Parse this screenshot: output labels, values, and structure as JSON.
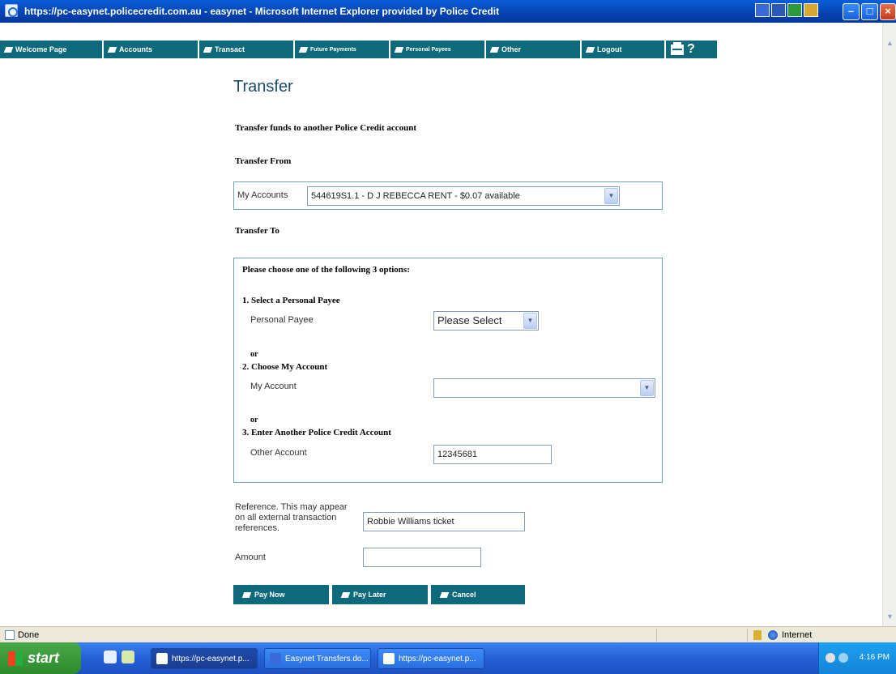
{
  "window": {
    "title": "https://pc-easynet.policecredit.com.au - easynet - Microsoft Internet Explorer provided by Police Credit"
  },
  "nav": {
    "items": [
      "Welcome Page",
      "Accounts",
      "Transact",
      "Future Payments",
      "Personal Payees",
      "Other",
      "Logout"
    ],
    "help": "?"
  },
  "page": {
    "title": "Transfer",
    "subtitle": "Transfer funds to another Police Credit account",
    "from_heading": "Transfer From",
    "from_label": "My Accounts",
    "from_value": "544619S1.1 - D J REBECCA RENT - $0.07 available",
    "to_heading": "Transfer To",
    "options_heading": "Please choose one of the following 3 options:",
    "opt1_title": "1. Select a Personal Payee",
    "opt1_label": "Personal Payee",
    "opt1_value": "Please Select",
    "or1": "or",
    "opt2_title": "2. Choose My Account",
    "opt2_label": "My Account",
    "opt2_value": "",
    "or2": "or",
    "opt3_title": "3. Enter Another Police Credit Account",
    "opt3_label": "Other Account",
    "opt3_value": "12345681",
    "reference_label": "Reference. This may appear on all external transaction references.",
    "reference_value": "Robbie Williams ticket",
    "amount_label": "Amount",
    "amount_value": ""
  },
  "buttons": {
    "pay_now": "Pay Now",
    "pay_later": "Pay Later",
    "cancel": "Cancel"
  },
  "statusbar": {
    "status": "Done",
    "zone": "Internet"
  },
  "taskbar": {
    "start": "start",
    "tasks": [
      "https://pc-easynet.p...",
      "Easynet Transfers.do...",
      "https://pc-easynet.p..."
    ],
    "clock": "4:16 PM"
  }
}
